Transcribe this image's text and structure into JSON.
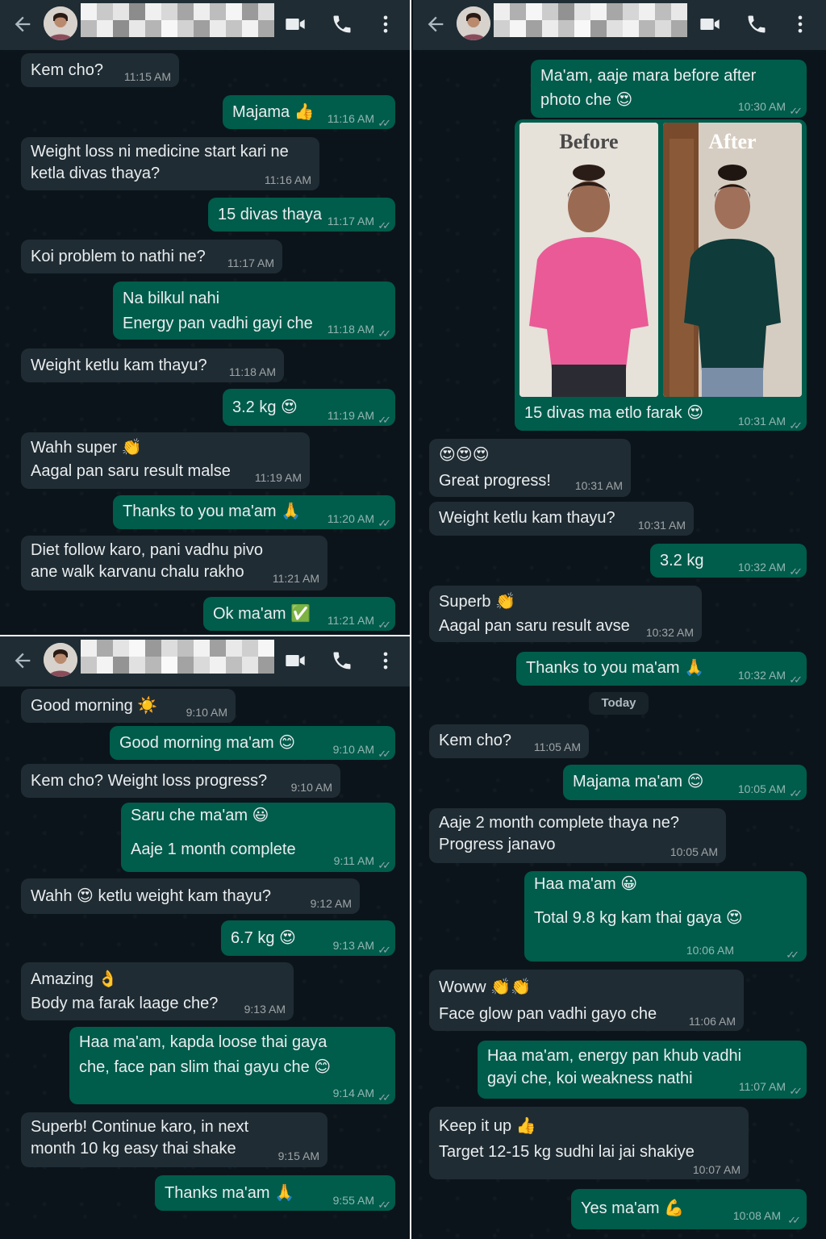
{
  "colors": {
    "incoming": "#202c33",
    "outgoing": "#005c4b",
    "header": "#1f2c34",
    "background": "#0b141a"
  },
  "icons": {
    "back": "arrow-left-icon",
    "video": "video-camera-icon",
    "call": "phone-icon",
    "menu": "more-vertical-icon"
  },
  "panel1": {
    "messages": [
      {
        "text": "Kem cho?",
        "time": "11:15 AM"
      },
      {
        "text": "Majama 👍",
        "time": "11:16 AM"
      },
      {
        "text": "Weight loss ni medicine start kari ne\nketla divas thaya?",
        "time": "11:16 AM"
      },
      {
        "text": "15 divas thaya",
        "time": "11:17 AM"
      },
      {
        "text": "Koi problem to nathi ne?",
        "time": "11:17 AM"
      },
      {
        "text": "Na bilkul nahi\nEnergy pan vadhi gayi che",
        "time": "11:18 AM"
      },
      {
        "text": "Weight ketlu kam thayu?",
        "time": "11:18 AM"
      },
      {
        "text": "3.2 kg 😍",
        "time": "11:19 AM"
      },
      {
        "text": "Wahh super 👏\nAagal pan saru result malse",
        "time": "11:19 AM"
      },
      {
        "text": "Thanks to you ma'am 🙏",
        "time": "11:20 AM"
      },
      {
        "text": "Diet follow karo, pani vadhu pivo\nane walk karvanu chalu rakho",
        "time": "11:21 AM"
      },
      {
        "text": "Ok ma'am ✅",
        "time": "11:21 AM"
      }
    ]
  },
  "panel2": {
    "messages": [
      {
        "text": "Good morning ☀️",
        "time": "9:10 AM"
      },
      {
        "text": "Good morning ma'am 😊",
        "time": "9:10 AM"
      },
      {
        "text": "Kem cho? Weight loss progress?",
        "time": "9:10 AM"
      },
      {
        "text": "Saru che ma'am 😃\n\nAaje 1 month complete",
        "time": "9:11 AM"
      },
      {
        "text": "Wahh 😍 ketlu weight kam thayu?",
        "time": "9:12 AM"
      },
      {
        "text": "6.7 kg 😍",
        "time": "9:13 AM"
      },
      {
        "text": "Amazing 👌\nBody ma farak laage che?",
        "time": "9:13 AM"
      },
      {
        "text": "Haa ma'am, kapda loose thai gaya\nche, face pan slim thai gayu che 😊",
        "time": "9:14 AM"
      },
      {
        "text": "Superb! Continue karo, in next\nmonth 10 kg easy thai shake",
        "time": "9:15 AM"
      },
      {
        "text": "Thanks ma'am 🙏",
        "time": "9:55 AM"
      }
    ]
  },
  "panel3": {
    "photo_labels": {
      "before": "Before",
      "after": "After"
    },
    "day_separator": "Today",
    "messages": [
      {
        "text": "Ma'am, aaje mara before after\nphoto che 😍",
        "time": "10:30 AM"
      },
      {
        "text": "15 divas ma etlo farak 😍",
        "time": "10:31 AM"
      },
      {
        "text": "😍😍😍\nGreat progress!",
        "time": "10:31 AM"
      },
      {
        "text": "Weight ketlu kam thayu?",
        "time": "10:31 AM"
      },
      {
        "text": "3.2 kg",
        "time": "10:32 AM"
      },
      {
        "text": "Superb 👏\nAagal pan saru result avse",
        "time": "10:32 AM"
      },
      {
        "text": "Thanks to you ma'am 🙏",
        "time": "10:32 AM"
      },
      {
        "text": "Kem cho?",
        "time": "11:05 AM"
      },
      {
        "text": "Majama ma'am 😊",
        "time": "10:05 AM"
      },
      {
        "text": "Aaje 2 month complete thaya ne?\nProgress janavo",
        "time": "10:05 AM"
      },
      {
        "text": "Haa ma'am 😀\n\nTotal 9.8 kg kam thai gaya 😍",
        "time": "10:06 AM"
      },
      {
        "text": "Woww 👏👏\nFace glow pan vadhi gayo che",
        "time": "11:06 AM"
      },
      {
        "text": "Haa ma'am, energy pan khub vadhi\ngayi che, koi weakness nathi",
        "time": "11:07 AM"
      },
      {
        "text": "Keep it up 👍\nTarget 12-15 kg sudhi lai jai shakiye",
        "time": "10:07 AM"
      },
      {
        "text": "Yes ma'am 💪",
        "time": "10:08 AM"
      }
    ]
  }
}
